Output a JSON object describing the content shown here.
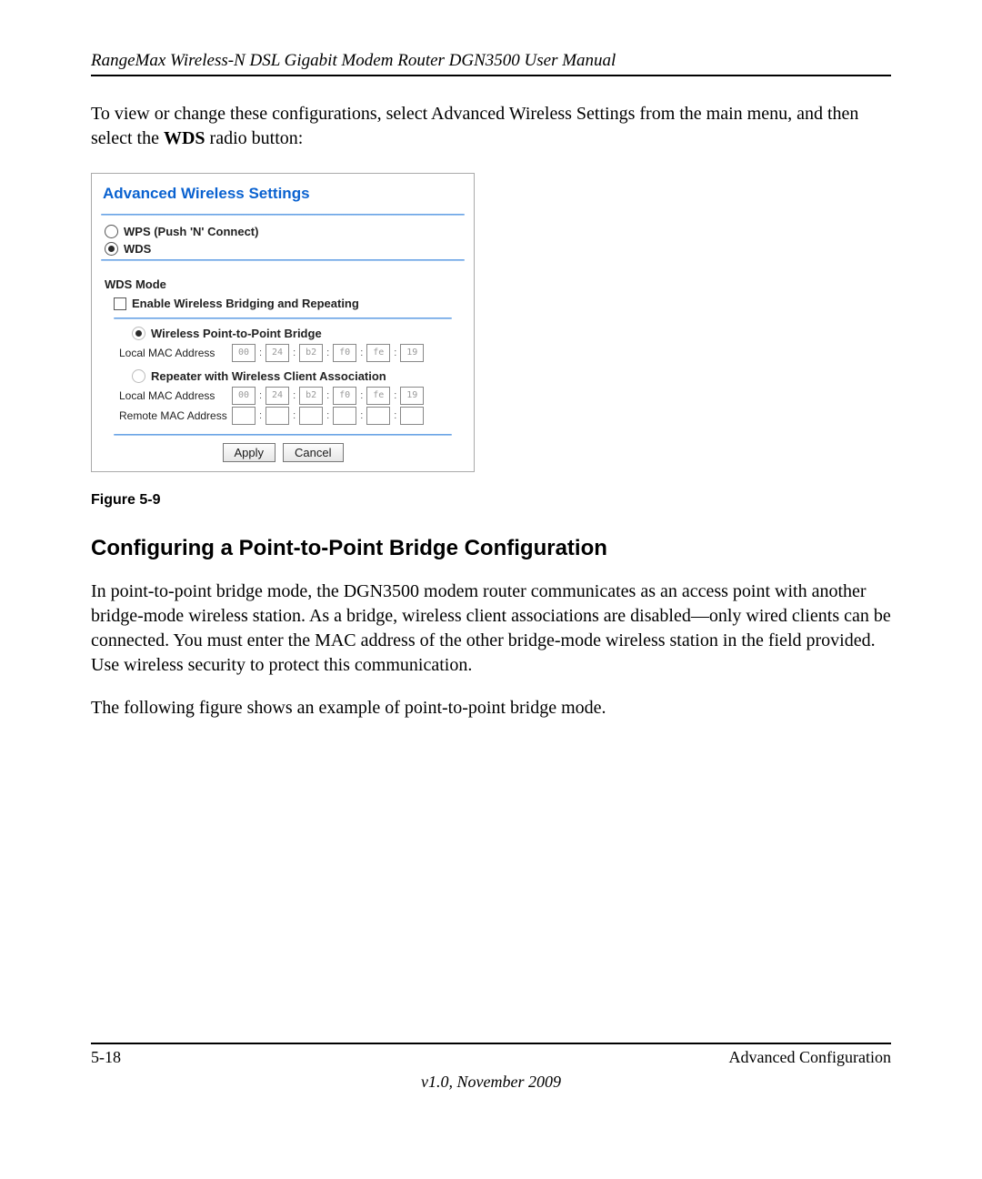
{
  "header": {
    "title": "RangeMax Wireless-N DSL Gigabit Modem Router DGN3500 User Manual"
  },
  "intro": {
    "line1": "To view or change these configurations, select Advanced Wireless Settings from the main menu, and then select the ",
    "wds_bold": "WDS",
    "line2": " radio button:"
  },
  "panel": {
    "title": "Advanced Wireless Settings",
    "radio_wps": "WPS (Push 'N' Connect)",
    "radio_wds": "WDS",
    "wds_mode_label": "WDS Mode",
    "enable_label": "Enable Wireless Bridging and Repeating",
    "option_p2p": "Wireless Point-to-Point Bridge",
    "option_repeater": "Repeater with Wireless Client Association",
    "mac_local_label": "Local MAC Address",
    "mac_remote_label": "Remote MAC Address",
    "mac_local": [
      "00",
      "24",
      "b2",
      "f0",
      "fe",
      "19"
    ],
    "mac_remote": [
      "",
      "",
      "",
      "",
      "",
      ""
    ],
    "btn_apply": "Apply",
    "btn_cancel": "Cancel"
  },
  "figure_caption": "Figure 5-9",
  "section_heading": "Configuring a Point-to-Point Bridge Configuration",
  "para1": "In point-to-point bridge mode, the DGN3500 modem router communicates as an access point with another bridge-mode wireless station. As a bridge, wireless client associations are disabled—only wired clients can be connected. You must enter the MAC address of the other bridge-mode wireless station in the field provided. Use wireless security to protect this communication.",
  "para2": "The following figure shows an example of point-to-point bridge mode.",
  "footer": {
    "page_num": "5-18",
    "section": "Advanced Configuration",
    "version": "v1.0, November 2009"
  }
}
